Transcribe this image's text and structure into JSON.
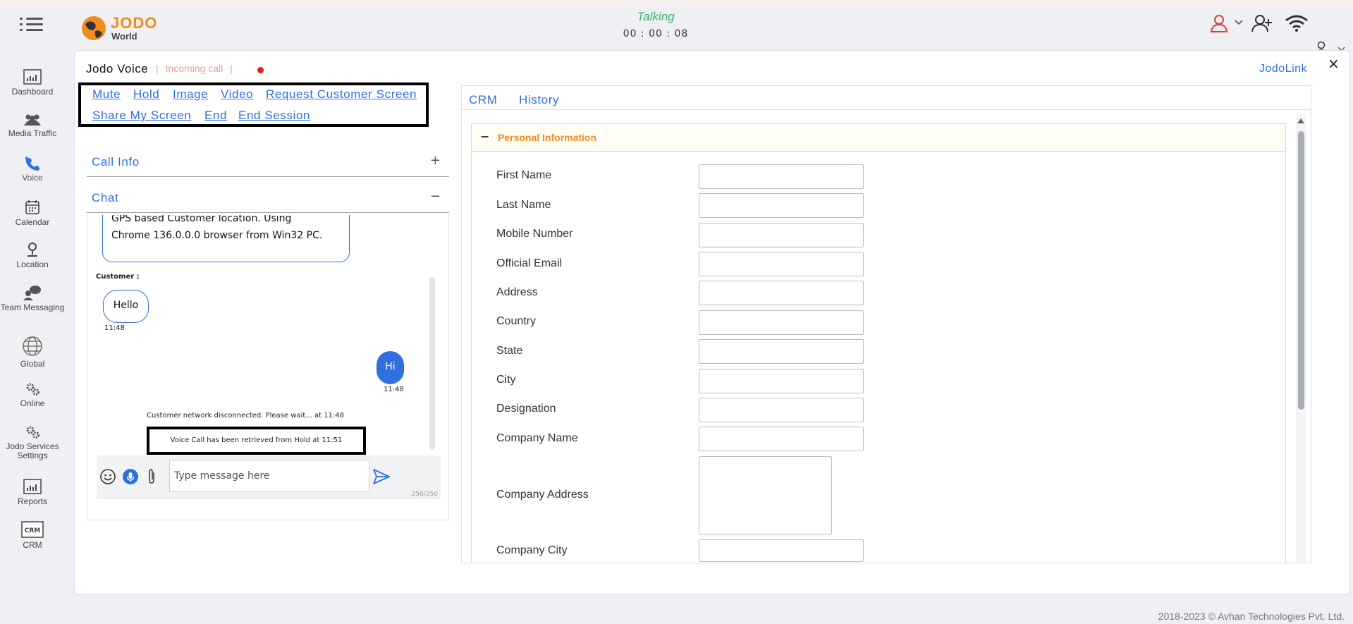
{
  "header": {
    "logo_text": "JODO",
    "logo_sub": "World",
    "status": "Talking",
    "timer": "00 : 00 : 08"
  },
  "sidebar": {
    "items": [
      {
        "label": "Dashboard",
        "icon": "dashboard-icon"
      },
      {
        "label": "Media Traffic",
        "icon": "media-traffic-icon"
      },
      {
        "label": "Voice",
        "icon": "phone-icon"
      },
      {
        "label": "Calendar",
        "icon": "calendar-icon"
      },
      {
        "label": "Location",
        "icon": "location-pin-icon"
      },
      {
        "label": "Team Messaging",
        "icon": "team-messaging-icon"
      },
      {
        "label": "Global",
        "icon": "globe-icon"
      },
      {
        "label": "Online",
        "icon": "gears-icon"
      },
      {
        "label": "Jodo Services Settings",
        "icon": "settings-gears-icon"
      },
      {
        "label": "Reports",
        "icon": "reports-icon"
      },
      {
        "label": "CRM",
        "icon": "crm-icon"
      }
    ]
  },
  "session": {
    "title": "Jodo Voice",
    "separator": "|",
    "state": "Incoming call",
    "jodolink": "JodoLink",
    "close": "×"
  },
  "actions": {
    "mute": "Mute",
    "hold": "Hold",
    "image": "Image",
    "video": "Video",
    "request_screen": "Request Customer Screen",
    "share_screen": "Share My Screen",
    "end": "End",
    "end_session": "End Session"
  },
  "accordions": {
    "call_info": {
      "label": "Call Info",
      "toggle": "+"
    },
    "chat": {
      "label": "Chat",
      "toggle": "−"
    }
  },
  "chat": {
    "location_line1": "GPS based Customer location. Using",
    "location_line2": "Chrome 136.0.0.0 browser from Win32 PC.",
    "customer_label": "Customer :",
    "customer_msg": "Hello",
    "customer_time": "11:48",
    "agent_msg": "Hi",
    "agent_time": "11:48",
    "system_msg": "Customer network disconnected. Please wait... at 11:48",
    "hold_msg": "Voice Call has been retrieved from Hold at 11:51",
    "input_placeholder": "Type message here",
    "counter": "250/250"
  },
  "crm": {
    "tabs": [
      "CRM",
      "History"
    ],
    "section_toggle": "−",
    "section_title": "Personal Information",
    "fields": [
      "First Name",
      "Last Name",
      "Mobile Number",
      "Official Email",
      "Address",
      "Country",
      "State",
      "City",
      "Designation",
      "Company Name",
      "Company Address",
      "Company City"
    ]
  },
  "footer": "2018-2023 © Avhan Technologies Pvt. Ltd.",
  "colors": {
    "accent": "#2f6fe0",
    "brand_orange": "#f08c1e",
    "talking_green": "#3ab27a",
    "incoming_salmon": "#e8a090",
    "record_red": "#e41b1b"
  }
}
